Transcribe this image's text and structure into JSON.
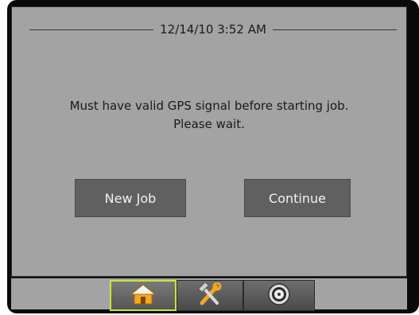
{
  "header": {
    "datetime": "12/14/10 3:52 AM"
  },
  "message": {
    "line1": "Must have valid GPS signal before starting job.",
    "line2": "Please wait."
  },
  "buttons": {
    "new_job": "New Job",
    "continue": "Continue"
  },
  "tabs": [
    {
      "icon": "home-icon",
      "active": true
    },
    {
      "icon": "tools-icon",
      "active": false
    },
    {
      "icon": "gauge-icon",
      "active": false
    }
  ],
  "colors": {
    "screen_bg": "#a3a3a3",
    "button_bg": "#606060",
    "active_tab_border": "#c7e63a",
    "home_icon": "#f5a623"
  }
}
